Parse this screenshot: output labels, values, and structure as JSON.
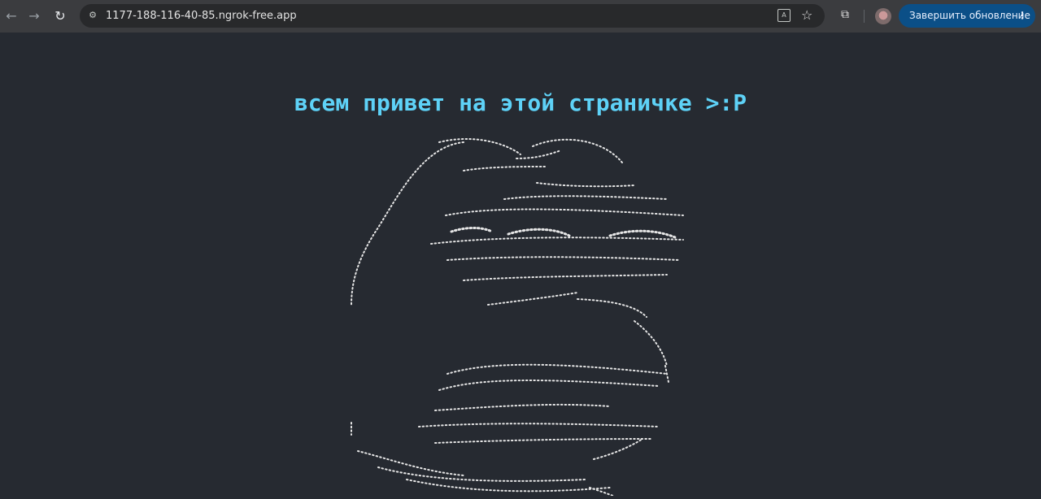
{
  "browser": {
    "url": "1177-188-116-40-85.ngrok-free.app",
    "update_button_label": "Завершить обновление",
    "icons": [
      "back-icon",
      "forward-icon",
      "reload-icon",
      "site-info-icon",
      "translate-icon",
      "star-icon",
      "extensions-icon",
      "profile-avatar",
      "more-vert-icon"
    ]
  },
  "page": {
    "heading": "всем привет на этой страничке >:P",
    "heading_color": "#5ed2f7",
    "background": "#262a31",
    "art_color": "#e6e6e6"
  }
}
